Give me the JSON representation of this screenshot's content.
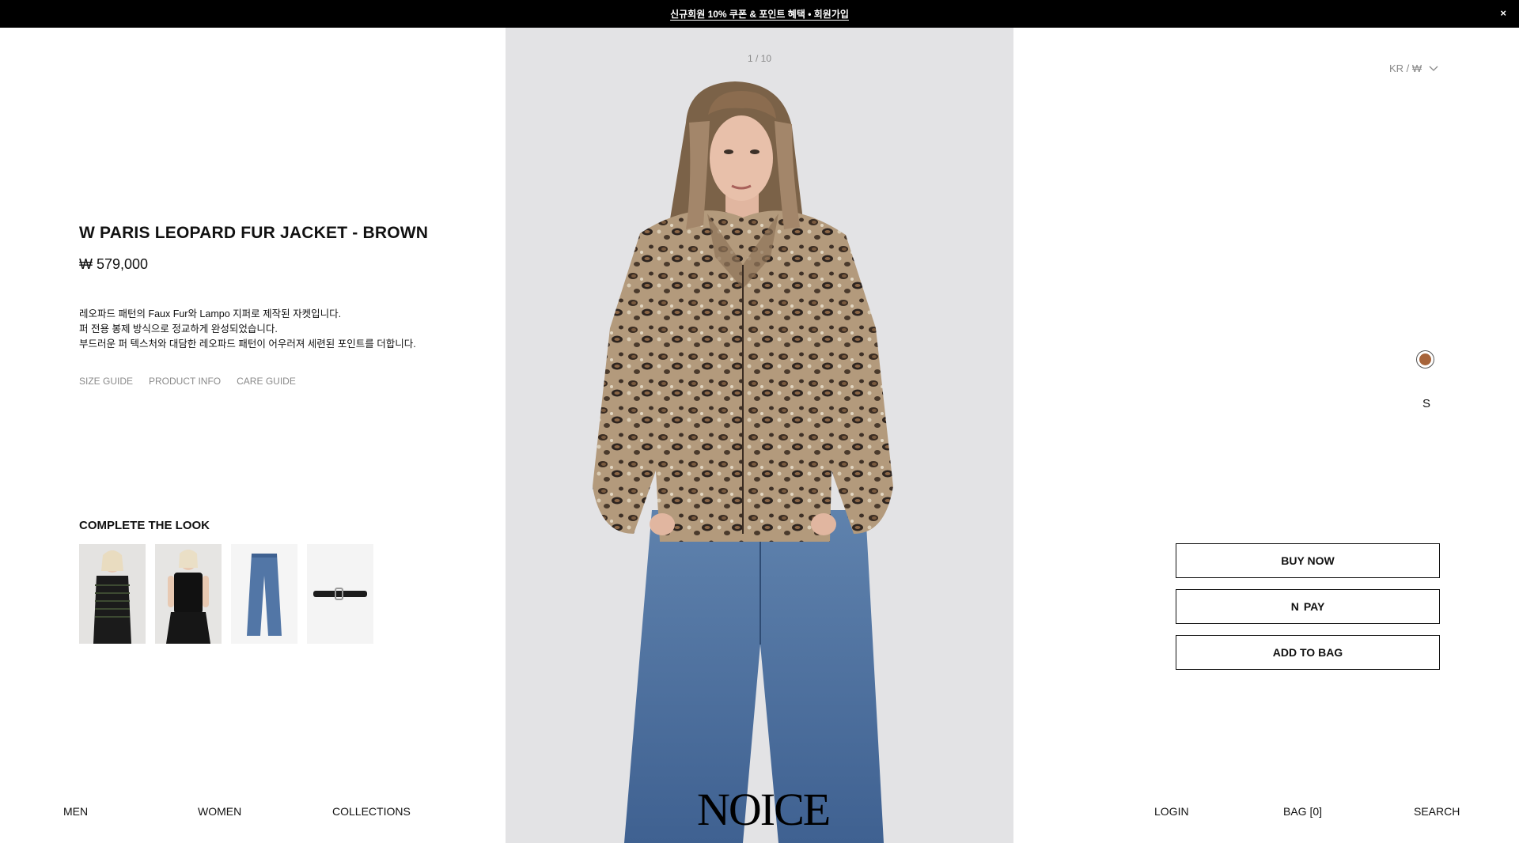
{
  "announcement": {
    "text": "신규회원 10% 쿠폰 & 포인트 혜택 • 회원가입",
    "close_glyph": "×"
  },
  "gallery": {
    "counter": "1 / 10"
  },
  "brand": {
    "logo": "NOICE"
  },
  "region": {
    "label": "KR / ₩"
  },
  "product": {
    "title": "W PARIS LEOPARD FUR JACKET - BROWN",
    "price": "₩ 579,000",
    "description": [
      "레오파드 패턴의 Faux Fur와 Lampo 지퍼로 제작된 자켓입니다.",
      "퍼 전용 봉제 방식으로 정교하게 완성되었습니다.",
      "부드러운 퍼 텍스처와 대담한 레오파드 패턴이 어우러져 세련된 포인트를 더합니다."
    ],
    "links": [
      "SIZE GUIDE",
      "PRODUCT INFO",
      "CARE GUIDE"
    ]
  },
  "complete_the_look": {
    "title": "COMPLETE THE LOOK",
    "items": [
      "striped-cardigan",
      "black-tank-top",
      "denim-jeans",
      "black-belt"
    ]
  },
  "options": {
    "color": "#a7643a",
    "size": "S"
  },
  "actions": {
    "buy_now": "BUY NOW",
    "npay": "PAY",
    "npay_logo": "N",
    "add_to_bag": "ADD TO BAG"
  },
  "nav": {
    "left": [
      "MEN",
      "WOMEN",
      "COLLECTIONS"
    ],
    "right": [
      "LOGIN",
      "BAG [0]",
      "SEARCH"
    ]
  }
}
